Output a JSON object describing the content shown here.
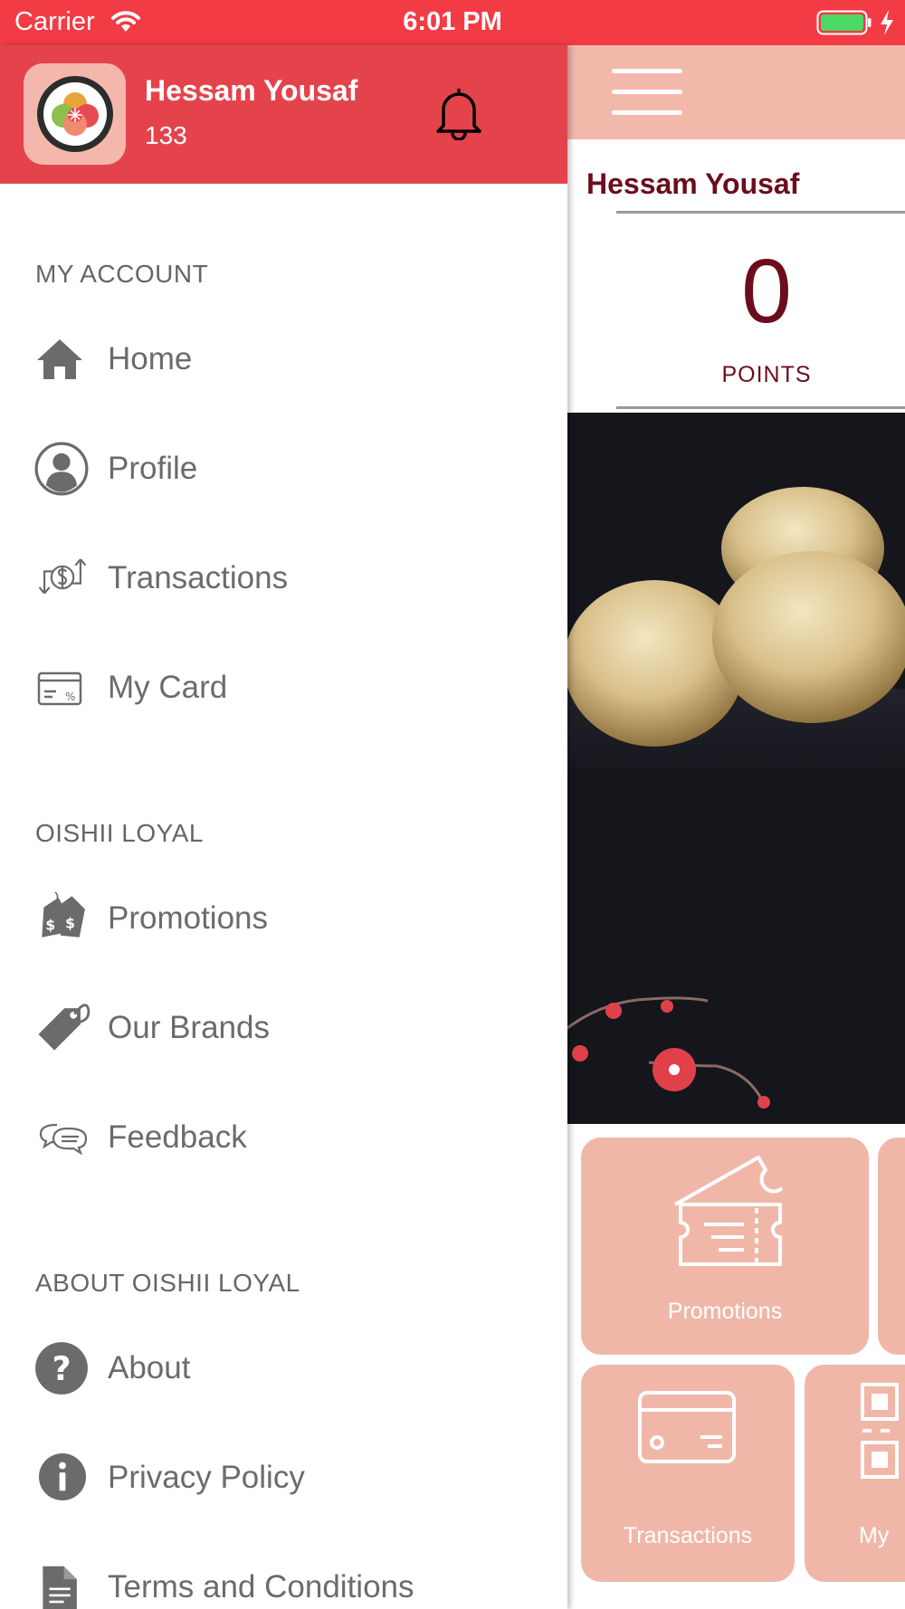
{
  "status_bar": {
    "carrier": "Carrier",
    "time": "6:01 PM",
    "icons": [
      "wifi-icon",
      "battery-icon",
      "charging-icon"
    ]
  },
  "drawer": {
    "user_name": "Hessam Yousaf",
    "user_points": "133",
    "sections": [
      {
        "title": "MY ACCOUNT",
        "items": [
          {
            "label": "Home",
            "icon": "home-icon"
          },
          {
            "label": "Profile",
            "icon": "profile-icon"
          },
          {
            "label": "Transactions",
            "icon": "transactions-icon"
          },
          {
            "label": "My Card",
            "icon": "card-icon"
          }
        ]
      },
      {
        "title": "OISHII LOYAL",
        "items": [
          {
            "label": "Promotions",
            "icon": "price-tags-icon"
          },
          {
            "label": "Our Brands",
            "icon": "tag-icon"
          },
          {
            "label": "Feedback",
            "icon": "chat-bubbles-icon"
          }
        ]
      },
      {
        "title": "ABOUT OISHII LOYAL",
        "items": [
          {
            "label": "About",
            "icon": "question-icon"
          },
          {
            "label": "Privacy Policy",
            "icon": "info-icon"
          },
          {
            "label": "Terms and Conditions",
            "icon": "document-icon"
          }
        ]
      }
    ]
  },
  "main": {
    "user_name": "Hessam Yousaf",
    "points_value": "0",
    "points_label": "POINTS",
    "tiles": [
      {
        "label": "Promotions",
        "icon": "ticket-icon"
      },
      {
        "label": "Transactions",
        "icon": "credit-card-icon"
      },
      {
        "label": "My",
        "icon": "qr-code-icon"
      }
    ]
  },
  "colors": {
    "status_bar": "#f23b45",
    "drawer_header": "#e5434c",
    "accent_light": "#f2b8aa",
    "brand_dark_red": "#6b0d1c",
    "menu_text": "#6b6b6b"
  }
}
